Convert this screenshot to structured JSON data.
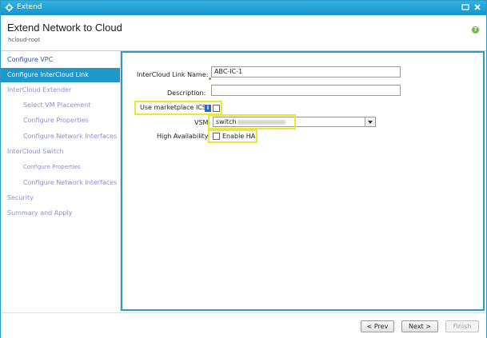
{
  "window": {
    "title": "Extend",
    "icon": "gear-icon"
  },
  "header": {
    "title": "Extend Network to Cloud",
    "subtitle": "hcloud-root",
    "help_icon": "help-icon",
    "help_glyph": "?"
  },
  "sidebar": {
    "items": [
      {
        "label": "Configure VPC",
        "state": "done"
      },
      {
        "label": "Configure InterCloud Link",
        "state": "active"
      },
      {
        "label": "InterCloud Extender",
        "state": "pending"
      },
      {
        "label": "Select VM Placement",
        "state": "pending"
      },
      {
        "label": "Configure Properties",
        "state": "pending"
      },
      {
        "label": "Configure Network Interfaces",
        "state": "pending"
      },
      {
        "label": "InterCloud Switch",
        "state": "pending"
      },
      {
        "label": "Configure Properties",
        "state": "pending"
      },
      {
        "label": "Configure Network Interfaces",
        "state": "pending"
      },
      {
        "label": "Security",
        "state": "pending"
      },
      {
        "label": "Summary and Apply",
        "state": "pending"
      }
    ]
  },
  "form": {
    "link_name_label": "InterCloud Link Name:",
    "link_name_value": "ABC-IC-1",
    "description_label": "Description:",
    "description_value": "",
    "marketplace_label": "Use marketplace ICS:",
    "marketplace_checked": false,
    "info_glyph": "i",
    "vsm_label": "VSM:",
    "vsm_value": "switch",
    "ha_label": "High Availability:",
    "ha_checkbox_label": "Enable HA",
    "ha_checked": false
  },
  "footer": {
    "prev_label": "< Prev",
    "next_label": "Next >",
    "finish_label": "Finish"
  },
  "colors": {
    "accent": "#1f97c9",
    "highlight": "#e6e83a",
    "done_link": "#2a55b5",
    "pending_link": "#8a8fd0"
  }
}
